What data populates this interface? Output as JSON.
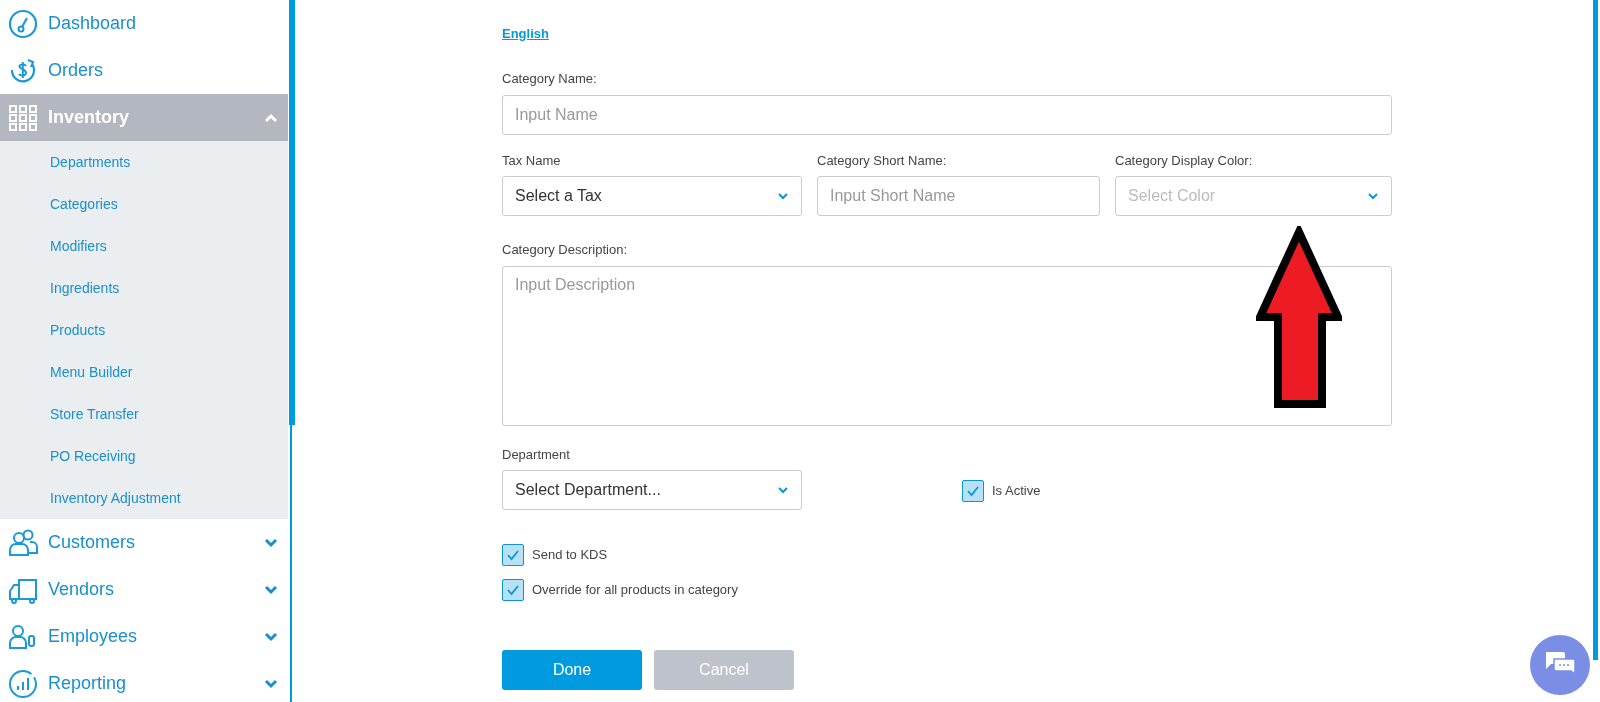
{
  "sidebar": {
    "items": [
      {
        "label": "Dashboard"
      },
      {
        "label": "Orders"
      },
      {
        "label": "Inventory",
        "expanded": true,
        "children": [
          {
            "label": "Departments"
          },
          {
            "label": "Categories"
          },
          {
            "label": "Modifiers"
          },
          {
            "label": "Ingredients"
          },
          {
            "label": "Products"
          },
          {
            "label": "Menu Builder"
          },
          {
            "label": "Store Transfer"
          },
          {
            "label": "PO Receiving"
          },
          {
            "label": "Inventory Adjustment"
          }
        ]
      },
      {
        "label": "Customers",
        "expanded": false
      },
      {
        "label": "Vendors",
        "expanded": false
      },
      {
        "label": "Employees",
        "expanded": false
      },
      {
        "label": "Reporting",
        "expanded": false
      }
    ]
  },
  "form": {
    "language_link": "English",
    "category_name": {
      "label": "Category Name:",
      "placeholder": "Input Name"
    },
    "tax_name": {
      "label": "Tax Name",
      "value": "Select a Tax"
    },
    "short_name": {
      "label": "Category Short Name:",
      "placeholder": "Input Short Name"
    },
    "display_color": {
      "label": "Category Display Color:",
      "placeholder": "Select Color"
    },
    "description": {
      "label": "Category Description:",
      "placeholder": "Input Description"
    },
    "department": {
      "label": "Department",
      "value": "Select Department..."
    },
    "is_active": {
      "label": "Is Active",
      "checked": true
    },
    "options": [
      {
        "label": "Send to KDS",
        "checked": true
      },
      {
        "label": "Override for all products in category",
        "checked": true
      }
    ],
    "buttons": [
      {
        "label": "Done",
        "kind": "primary"
      },
      {
        "label": "Cancel",
        "kind": "secondary"
      }
    ]
  }
}
